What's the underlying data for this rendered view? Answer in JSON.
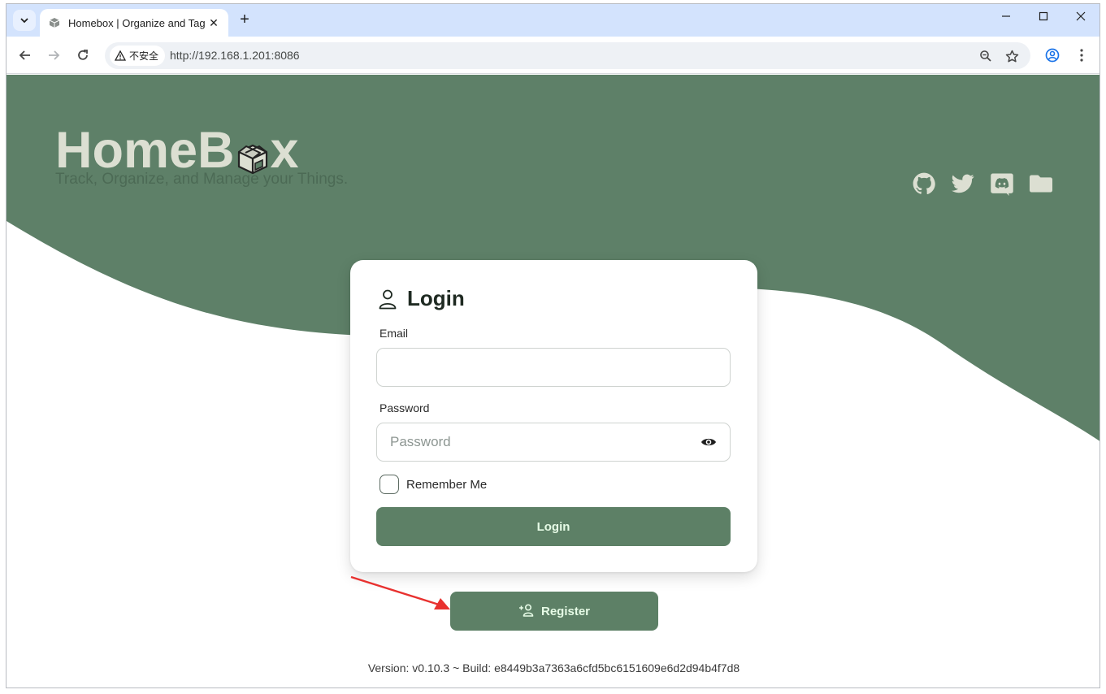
{
  "browser": {
    "tab": {
      "title": "Homebox | Organize and Tag",
      "favicon": "homebox-box-icon"
    },
    "address": {
      "security_label": "不安全",
      "url": "http://192.168.1.201:8086"
    }
  },
  "colors": {
    "brand_green": "#5d8066",
    "wave_green": "#5e8068",
    "brand_text": "#dcdfd2",
    "button_text": "#e6fbe6",
    "arrow_red": "#e8312f"
  },
  "header": {
    "brand_left": "HomeB",
    "brand_right": "x",
    "tagline": "Track, Organize, and Manage your Things.",
    "social_icons": [
      "github-icon",
      "twitter-icon",
      "discord-icon",
      "folder-icon"
    ]
  },
  "login": {
    "title": "Login",
    "email_label": "Email",
    "email_value": "",
    "password_label": "Password",
    "password_placeholder": "Password",
    "remember_label": "Remember Me",
    "remember_checked": false,
    "login_button": "Login"
  },
  "register": {
    "label": "Register"
  },
  "footer": {
    "version": "Version: v0.10.3 ~ Build: e8449b3a7363a6cfd5bc6151609e6d2d94b4f7d8"
  }
}
